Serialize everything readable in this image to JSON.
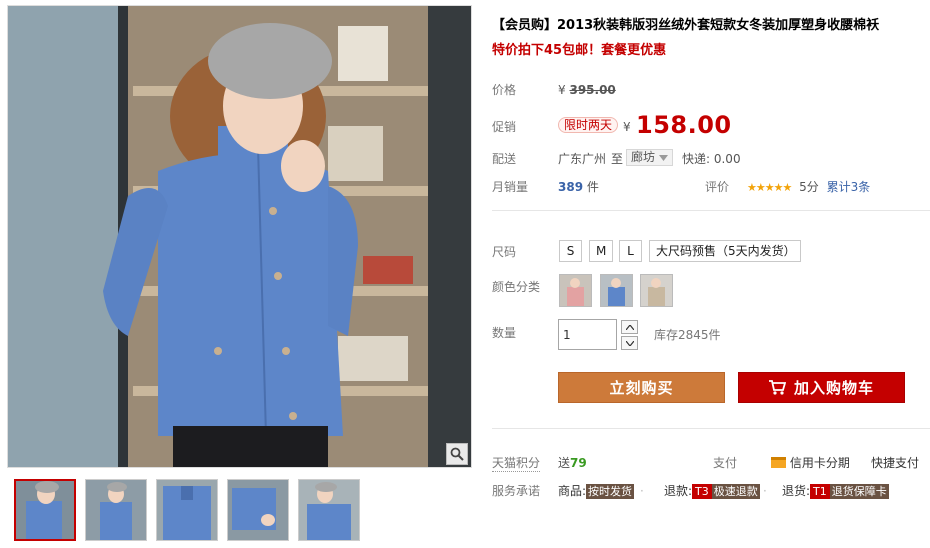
{
  "gallery": {
    "thumbnails": [
      "thumb-1",
      "thumb-2",
      "thumb-3",
      "thumb-4",
      "thumb-5"
    ],
    "zoom_icon": "magnifier-icon"
  },
  "product": {
    "title": "【会员购】2013秋装韩版羽丝绒外套短款女冬装加厚塑身收腰棉袄",
    "subtitle": "特价拍下45包邮！套餐更优惠"
  },
  "price": {
    "label": "价格",
    "currency": "¥",
    "original": "395.00"
  },
  "promo": {
    "label": "促销",
    "tag": "限时两天",
    "currency": "¥",
    "price": "158.00"
  },
  "shipping": {
    "label": "配送",
    "from": "广东广州",
    "to_label": "至",
    "to_city": "廊坊",
    "express": "快递: 0.00"
  },
  "sales": {
    "label": "月销量",
    "count": "389",
    "unit": "件",
    "rating_label": "评价",
    "stars": "★★★★★",
    "score": "5分",
    "reviews": "累计3条"
  },
  "size": {
    "label": "尺码",
    "options": [
      "S",
      "M",
      "L",
      "大尺码预售（5天内发货）"
    ]
  },
  "color": {
    "label": "颜色分类",
    "swatches": [
      "pink",
      "blue",
      "beige"
    ]
  },
  "quantity": {
    "label": "数量",
    "value": "1",
    "stock": "库存2845件"
  },
  "actions": {
    "buy_now": "立刻购买",
    "add_to_cart": "加入购物车"
  },
  "points": {
    "label": "天猫积分",
    "prefix": "送",
    "value": "79",
    "pay_label": "支付",
    "credit": "信用卡分期",
    "quick_pay": "快捷支付"
  },
  "service": {
    "label": "服务承诺",
    "goods_label": "商品:",
    "goods_badge": "按时发货",
    "refund_label": "退款:",
    "refund_code": "T3",
    "refund_badge": "极速退款",
    "return_label": "退货:",
    "return_code": "T1",
    "return_badge": "退货保障卡"
  },
  "colors": {
    "accent_red": "#c40000",
    "buy_orange": "#cd7a3a",
    "star_yellow": "#f2a30a",
    "link_blue": "#3a63a8"
  }
}
